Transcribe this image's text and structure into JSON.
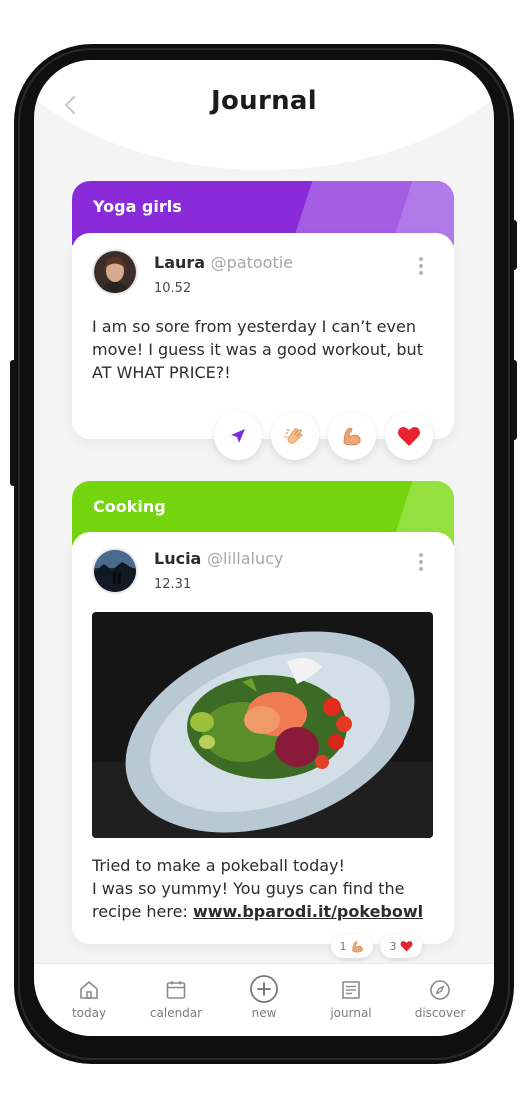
{
  "header": {
    "title": "Journal"
  },
  "posts": [
    {
      "group": "Yoga girls",
      "user": "Laura",
      "handle": "@patootie",
      "time": "10.52",
      "text": "I am so sore from yesterday I can’t even move! I guess it was a good workout, but AT WHAT PRICE?!",
      "actions": [
        "send-icon",
        "clap-icon",
        "flexed-biceps-icon",
        "heart-icon"
      ]
    },
    {
      "group": "Cooking",
      "user": "Lucia",
      "handle": "@lillalucy",
      "time": "12.31",
      "text_line1": "Tried to make a pokeball today!",
      "text_line2": "I was so yummy! You guys can find the",
      "text_line3_prefix": "recipe here:",
      "link": "www.bparodi.it/pokebowl",
      "reactions": [
        {
          "count": "1",
          "icon": "flexed-biceps-icon"
        },
        {
          "count": "3",
          "icon": "heart-icon"
        }
      ]
    }
  ],
  "nav": {
    "items": [
      {
        "label": "today",
        "icon": "home-icon"
      },
      {
        "label": "calendar",
        "icon": "calendar-icon"
      },
      {
        "label": "new",
        "icon": "plus-circle-icon"
      },
      {
        "label": "journal",
        "icon": "journal-icon"
      },
      {
        "label": "discover",
        "icon": "compass-icon"
      }
    ]
  },
  "colors": {
    "yoga": "#8e2fdc",
    "cooking": "#76d60f",
    "accent_purple": "#7a2de0",
    "heart": "#e8232f"
  }
}
